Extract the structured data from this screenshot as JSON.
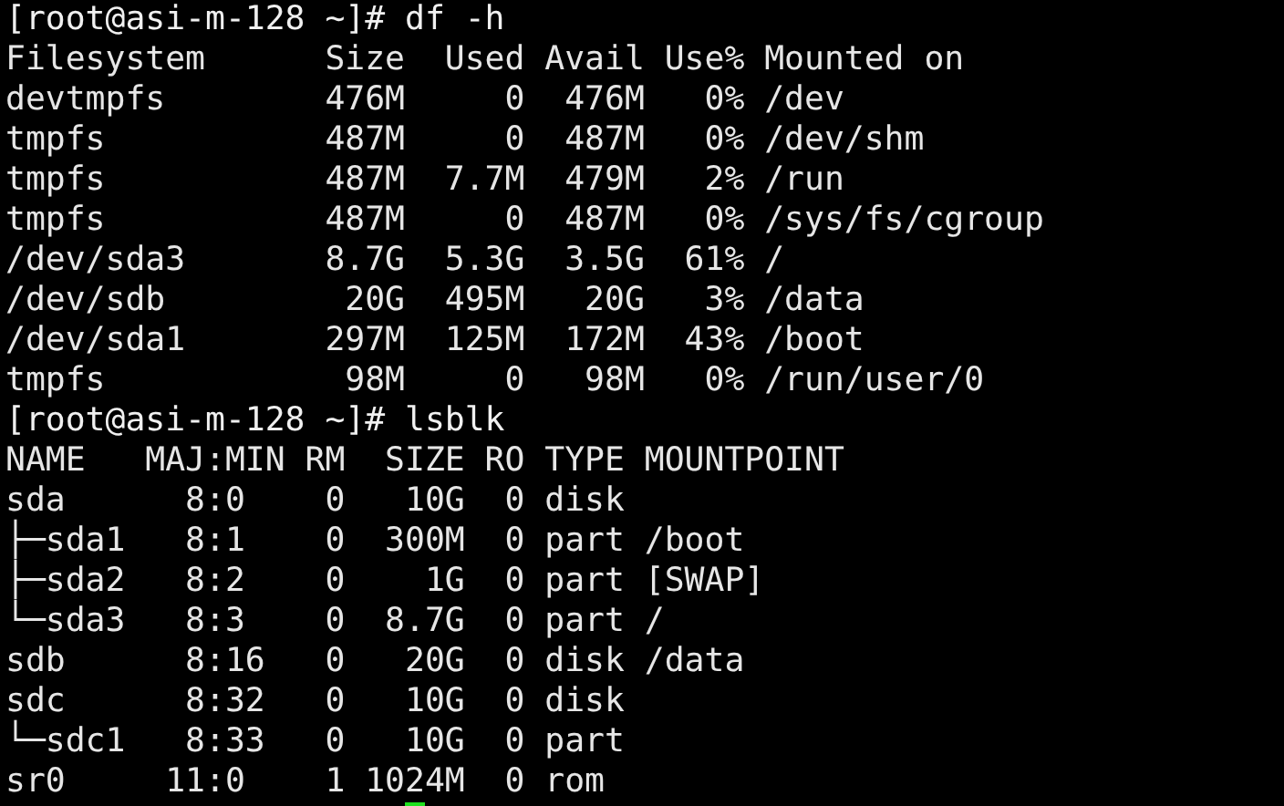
{
  "terminal": {
    "lines": [
      {
        "kind": "prompt",
        "text": "[root@asi-m-128 ~]# df -h"
      },
      {
        "kind": "output",
        "text": "Filesystem      Size  Used Avail Use% Mounted on"
      },
      {
        "kind": "output",
        "text": "devtmpfs        476M     0  476M   0% /dev"
      },
      {
        "kind": "output",
        "text": "tmpfs           487M     0  487M   0% /dev/shm"
      },
      {
        "kind": "output",
        "text": "tmpfs           487M  7.7M  479M   2% /run"
      },
      {
        "kind": "output",
        "text": "tmpfs           487M     0  487M   0% /sys/fs/cgroup"
      },
      {
        "kind": "output",
        "text": "/dev/sda3       8.7G  5.3G  3.5G  61% /"
      },
      {
        "kind": "output",
        "text": "/dev/sdb         20G  495M   20G   3% /data"
      },
      {
        "kind": "output",
        "text": "/dev/sda1       297M  125M  172M  43% /boot"
      },
      {
        "kind": "output",
        "text": "tmpfs            98M     0   98M   0% /run/user/0"
      },
      {
        "kind": "prompt",
        "text": "[root@asi-m-128 ~]# lsblk"
      },
      {
        "kind": "output",
        "text": "NAME   MAJ:MIN RM  SIZE RO TYPE MOUNTPOINT"
      },
      {
        "kind": "output",
        "text": "sda      8:0    0   10G  0 disk"
      },
      {
        "kind": "output",
        "text": "├─sda1   8:1    0  300M  0 part /boot"
      },
      {
        "kind": "output",
        "text": "├─sda2   8:2    0    1G  0 part [SWAP]"
      },
      {
        "kind": "output",
        "text": "└─sda3   8:3    0  8.7G  0 part /"
      },
      {
        "kind": "output",
        "text": "sdb      8:16   0   20G  0 disk /data"
      },
      {
        "kind": "output",
        "text": "sdc      8:32   0   10G  0 disk"
      },
      {
        "kind": "output",
        "text": "└─sdc1   8:33   0   10G  0 part"
      },
      {
        "kind": "output",
        "text": "sr0     11:0    1 1024M  0 rom"
      }
    ],
    "cursor": {
      "visible": true
    }
  }
}
